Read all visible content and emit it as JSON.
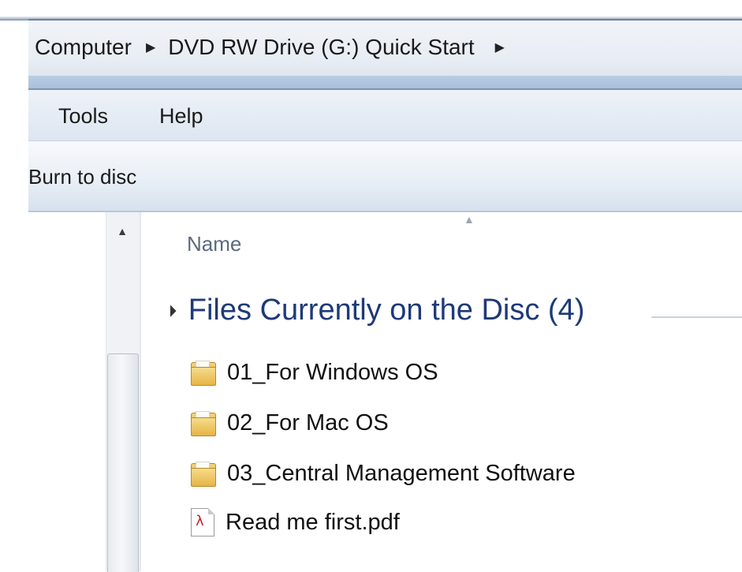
{
  "breadcrumb": {
    "items": [
      "Computer",
      "DVD RW Drive (G:) Quick Start"
    ],
    "separator_icon": "chevron-right-icon"
  },
  "menu": {
    "items": [
      {
        "label": "Tools"
      },
      {
        "label": "Help"
      }
    ]
  },
  "commands": {
    "burn_label": "Burn to disc"
  },
  "file_list": {
    "column_header": "Name",
    "group": {
      "title": "Files Currently on the Disc (4)"
    },
    "items": [
      {
        "name": "01_For Windows OS",
        "icon": "folder-icon"
      },
      {
        "name": "02_For Mac OS",
        "icon": "folder-icon"
      },
      {
        "name": "03_Central Management Software",
        "icon": "folder-icon"
      },
      {
        "name": "Read me first.pdf",
        "icon": "pdf-icon"
      }
    ]
  },
  "colors": {
    "group_title": "#1e3a78",
    "column_header": "#5b6b7d",
    "pdf_accent": "#c8232c"
  }
}
